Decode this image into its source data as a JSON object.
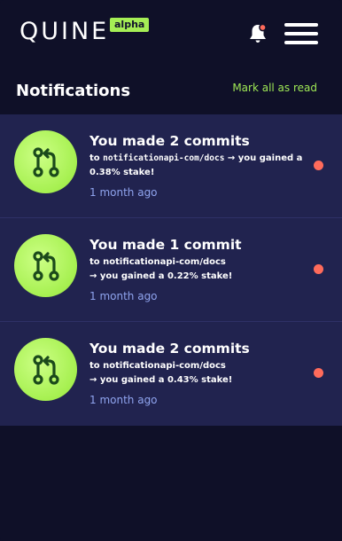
{
  "header": {
    "logo_text": "QUINE",
    "badge": "alpha",
    "bell_icon": "bell-icon",
    "menu_icon": "hamburger-menu-icon"
  },
  "page": {
    "title": "Notifications",
    "mark_all_read": "Mark all as read"
  },
  "notifications": [
    {
      "title": "You made 2 commits",
      "to_prefix": "to ",
      "repo": "notificationapi-com/docs",
      "gain": "→ you gained a 0.38% stake!",
      "time": "1 month ago",
      "icon": "git-pull-request-icon",
      "unread": true
    },
    {
      "title": "You made 1 commit",
      "to_prefix": "to ",
      "repo": "notificationapi-com/docs",
      "gain": "→ you gained a 0.22% stake!",
      "time": "1 month ago",
      "icon": "git-pull-request-icon",
      "unread": true
    },
    {
      "title": "You made 2 commits",
      "to_prefix": "to ",
      "repo": "notificationapi-com/docs",
      "gain": "→ you gained a 0.43% stake!",
      "time": "1 month ago",
      "icon": "git-pull-request-icon",
      "unread": true
    }
  ],
  "colors": {
    "background": "#0f1028",
    "card": "#21234f",
    "accent_green": "#a5ee55",
    "unread_dot": "#ff6b5b",
    "time_text": "#8fa4ee"
  }
}
